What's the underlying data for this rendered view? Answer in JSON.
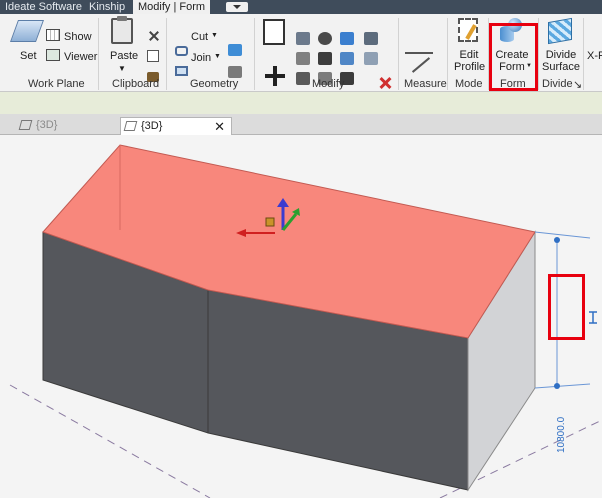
{
  "tabs": {
    "ideate": "Ideate Software",
    "kinship": "Kinship",
    "modify_form": "Modify | Form"
  },
  "ribbon": {
    "work_plane": {
      "set": "Set",
      "show": "Show",
      "viewer": "Viewer",
      "label": "Work Plane"
    },
    "clipboard": {
      "paste": "Paste",
      "label": "Clipboard"
    },
    "geometry": {
      "cut": "Cut",
      "join": "Join",
      "label": "Geometry"
    },
    "modify": {
      "label": "Modify"
    },
    "measure": {
      "label": "Measure"
    },
    "mode": {
      "edit_profile_line1": "Edit",
      "edit_profile_line2": "Profile",
      "label": "Mode"
    },
    "form": {
      "create_form_line1": "Create",
      "create_form_line2": "Form",
      "label": "Form"
    },
    "divide": {
      "divide_surface_line1": "Divide",
      "divide_surface_line2": "Surface",
      "label": "Divide",
      "launcher": "↘"
    },
    "xray_partial": "X-F"
  },
  "doc_tabs": {
    "inactive": "{3D}",
    "active": "{3D}",
    "close": "✕"
  },
  "viewport": {
    "dimension_value": "10800.0",
    "top_face_color": "#f8877c",
    "side_face_color": "#55575c",
    "end_face_color": "#d2d3d6",
    "dimension_color": "#2f6fc4"
  }
}
